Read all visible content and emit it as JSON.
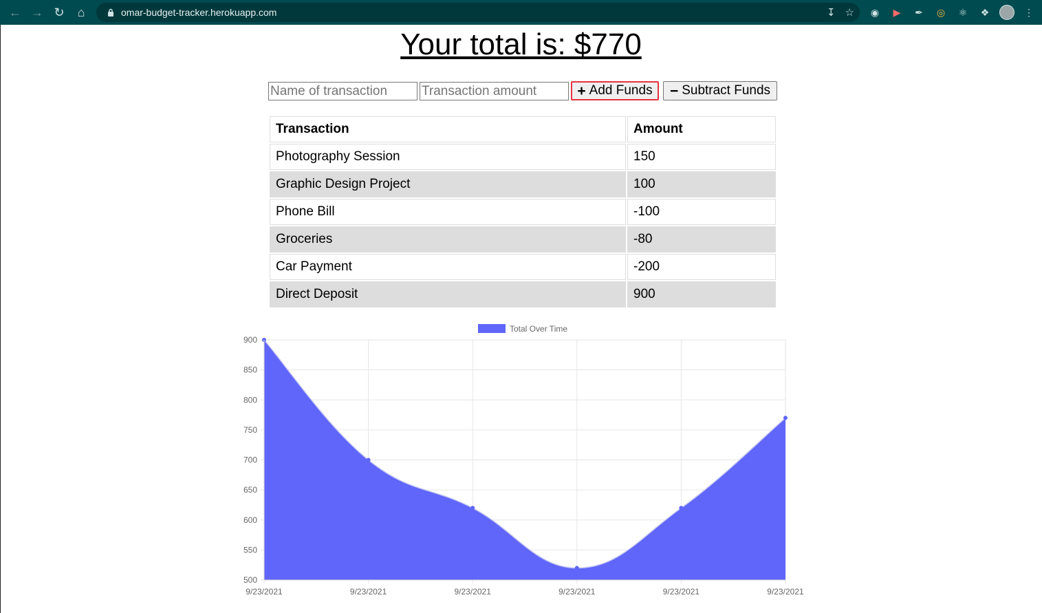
{
  "browser": {
    "url": "omar-budget-tracker.herokuapp.com",
    "nav_icons": [
      "back-arrow-icon",
      "forward-arrow-icon",
      "reload-icon",
      "home-icon"
    ]
  },
  "page": {
    "total_heading": "Your total is: $770",
    "name_placeholder": "Name of transaction",
    "amount_placeholder": "Transaction amount",
    "add_label": "Add Funds",
    "subtract_label": "Subtract Funds",
    "add_icon": "plus-icon",
    "subtract_icon": "minus-icon",
    "add_border_color": "#e5333f"
  },
  "table": {
    "headers": [
      "Transaction",
      "Amount"
    ],
    "rows": [
      {
        "name": "Photography Session",
        "amount": "150"
      },
      {
        "name": "Graphic Design Project",
        "amount": "100"
      },
      {
        "name": "Phone Bill",
        "amount": "-100"
      },
      {
        "name": "Groceries",
        "amount": "-80"
      },
      {
        "name": "Car Payment",
        "amount": "-200"
      },
      {
        "name": "Direct Deposit",
        "amount": "900"
      }
    ]
  },
  "chart_data": {
    "type": "area",
    "title": "",
    "xlabel": "",
    "ylabel": "",
    "categories": [
      "9/23/2021",
      "9/23/2021",
      "9/23/2021",
      "9/23/2021",
      "9/23/2021",
      "9/23/2021"
    ],
    "series": [
      {
        "name": "Total Over Time",
        "values": [
          900,
          700,
          620,
          520,
          620,
          770
        ],
        "color": "#6066fa"
      }
    ],
    "ylim": [
      500,
      900
    ],
    "yticks": [
      900,
      850,
      800,
      750,
      700,
      650,
      600,
      550,
      500
    ],
    "grid": true,
    "legend": "top-center"
  }
}
